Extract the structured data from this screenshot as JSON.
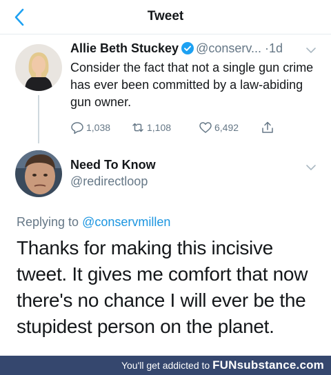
{
  "nav": {
    "title": "Tweet"
  },
  "tweet1": {
    "name": "Allie Beth Stuckey",
    "handle": "@conserv...",
    "separator": " ·",
    "time": "1d",
    "text": "Consider the fact that not a single gun crime has ever been committed by a law-abiding gun owner.",
    "replies": "1,038",
    "retweets": "1,108",
    "likes": "6,492"
  },
  "tweet2": {
    "name": "Need To Know",
    "handle": "@redirectloop",
    "replying_prefix": "Replying to ",
    "replying_to": "@conservmillen",
    "text": "Thanks for making this incisive tweet. It gives me comfort that now there's no chance I will ever be the stupidest person on the planet."
  },
  "footer": {
    "text": "You'll get addicted to ",
    "brand": "FUNsubstance.com"
  },
  "colors": {
    "accent": "#1da1f2",
    "muted": "#657786",
    "footer_bg": "#35476e"
  },
  "icons": [
    "back-chevron-icon",
    "verified-badge-icon",
    "caret-down-icon",
    "reply-icon",
    "retweet-icon",
    "like-icon",
    "share-icon"
  ]
}
